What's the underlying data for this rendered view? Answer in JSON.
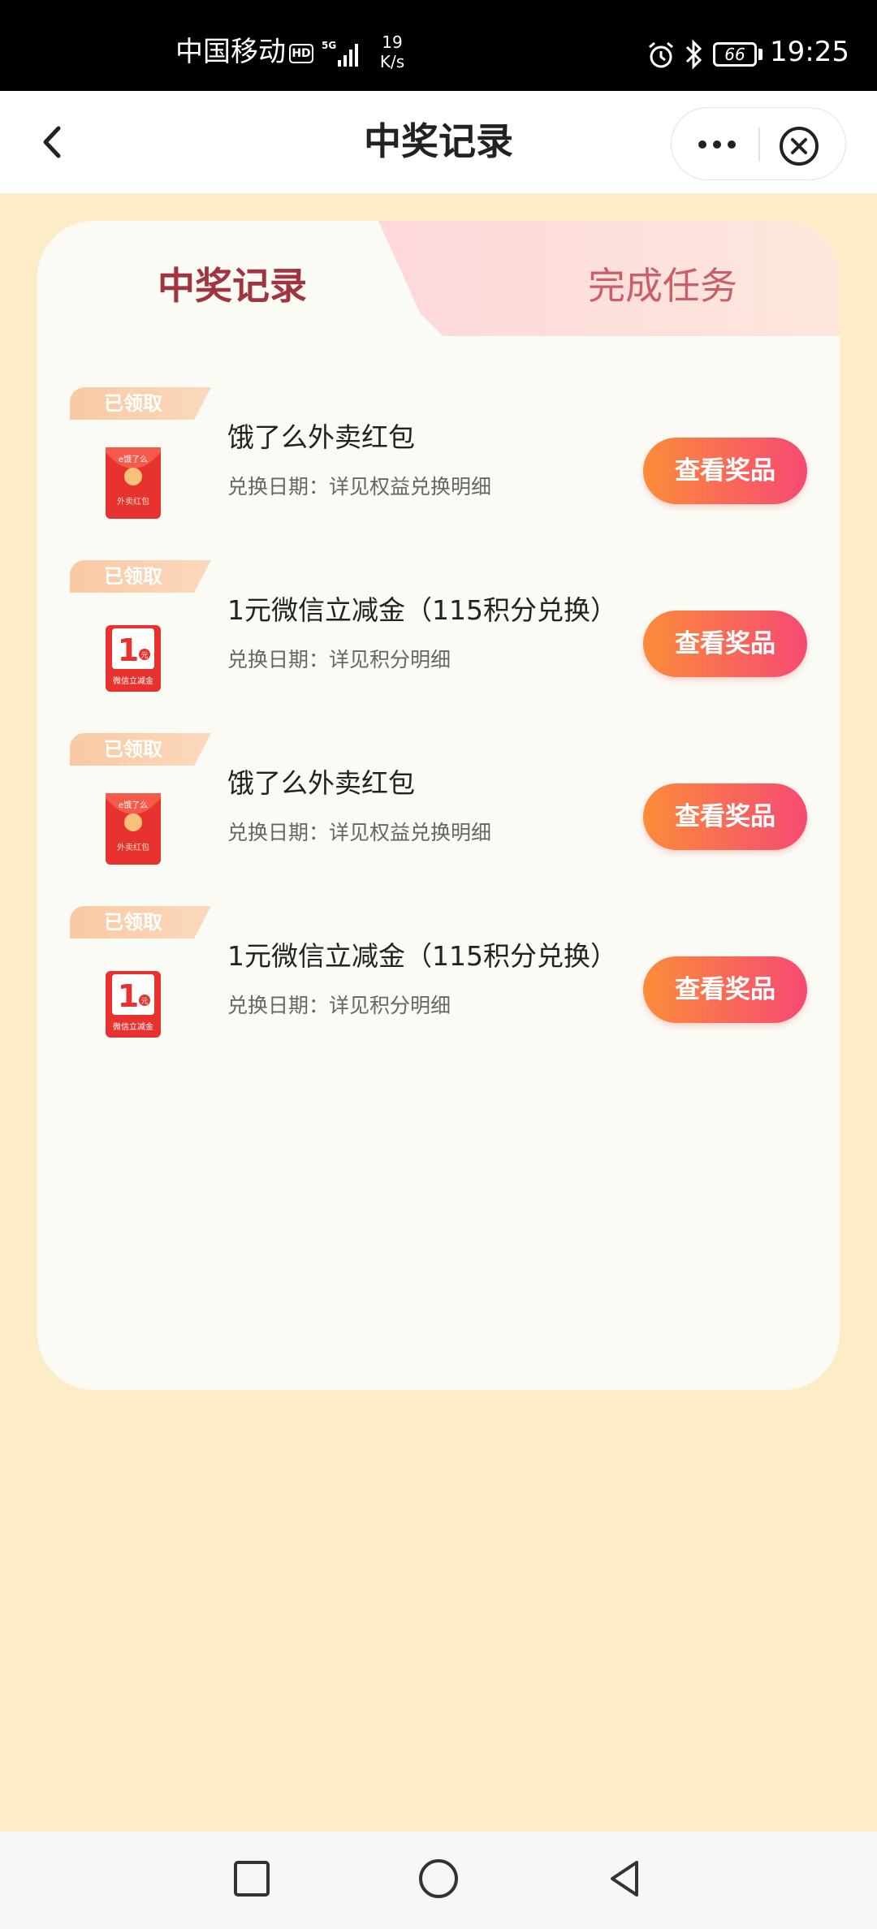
{
  "status_bar": {
    "carrier": "中国移动",
    "hd": "HD",
    "speed_value": "19",
    "speed_unit": "K/s",
    "battery": "66",
    "time": "19:25"
  },
  "nav": {
    "title": "中奖记录"
  },
  "tabs": [
    {
      "label": "中奖记录",
      "active": true
    },
    {
      "label": "完成任务",
      "active": false
    }
  ],
  "prizes": [
    {
      "badge": "已领取",
      "icon": "eleme-red-packet-icon",
      "title": "饿了么外卖红包",
      "date": "兑换日期：详见权益兑换明细",
      "button": "查看奖品"
    },
    {
      "badge": "已领取",
      "icon": "wechat-coupon-icon",
      "title": "1元微信立减金（115积分兑换）",
      "date": "兑换日期：详见积分明细",
      "button": "查看奖品"
    },
    {
      "badge": "已领取",
      "icon": "eleme-red-packet-icon",
      "title": "饿了么外卖红包",
      "date": "兑换日期：详见权益兑换明细",
      "button": "查看奖品"
    },
    {
      "badge": "已领取",
      "icon": "wechat-coupon-icon",
      "title": "1元微信立减金（115积分兑换）",
      "date": "兑换日期：详见积分明细",
      "button": "查看奖品"
    }
  ],
  "thumb_text": {
    "eleme_logo": "e饿了么",
    "eleme_caption": "外卖红包",
    "coupon_amount": "1",
    "coupon_unit": "元",
    "coupon_caption": "微信立减金"
  },
  "colors": {
    "page_bg": "#fdecc8",
    "card_bg": "#fbfbf6",
    "active_tab_text": "#a0343f",
    "inactive_tab_text": "#c96068",
    "button_gradient_start": "#fb8c3a",
    "button_gradient_end": "#f64a73"
  }
}
